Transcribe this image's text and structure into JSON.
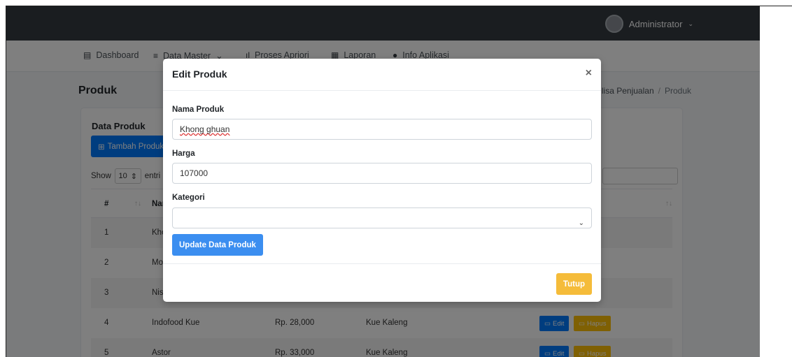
{
  "topbar": {
    "user_name": "Administrator",
    "caret": "⌄"
  },
  "nav": {
    "items": [
      {
        "label": "Dashboard",
        "icon": "▤"
      },
      {
        "label": "Data Master",
        "icon": "≡",
        "caret": "⌄"
      },
      {
        "label": "Proses Apriori",
        "icon": "ıl"
      },
      {
        "label": "Laporan",
        "icon": "▦"
      },
      {
        "label": "Info Aplikasi",
        "icon": "●"
      }
    ]
  },
  "page": {
    "title": "Produk",
    "breadcrumb": {
      "parent": "...lisa Penjualan",
      "current": "Produk"
    }
  },
  "card": {
    "title": "Data Produk",
    "add_button": "Tambah Produk",
    "show_label": "Show",
    "show_value": "10",
    "entries_label": "entri",
    "headers": {
      "no": "#",
      "name": "Nam"
    },
    "rows": [
      {
        "no": "1",
        "name": "Khor",
        "price": "",
        "category": ""
      },
      {
        "no": "2",
        "name": "Mon",
        "price": "",
        "category": ""
      },
      {
        "no": "3",
        "name": "Nissi",
        "price": "",
        "category": ""
      },
      {
        "no": "4",
        "name": "Indofood Kue",
        "price": "Rp. 28,000",
        "category": "Kue Kaleng"
      },
      {
        "no": "5",
        "name": "Astor",
        "price": "Rp. 33,000",
        "category": "Kue Kaleng"
      }
    ],
    "edit_label": "Edit",
    "hapus_label": "Hapus"
  },
  "modal": {
    "title": "Edit Produk",
    "close": "×",
    "fields": {
      "nama_label": "Nama Produk",
      "nama_value": "Khong ghuan",
      "harga_label": "Harga",
      "harga_value": "107000",
      "kategori_label": "Kategori",
      "kategori_value": ""
    },
    "update_button": "Update Data Produk",
    "tutup_button": "Tutup"
  },
  "colors": {
    "primary": "#007bff",
    "warning": "#ffc107",
    "topbar": "#343a40"
  }
}
